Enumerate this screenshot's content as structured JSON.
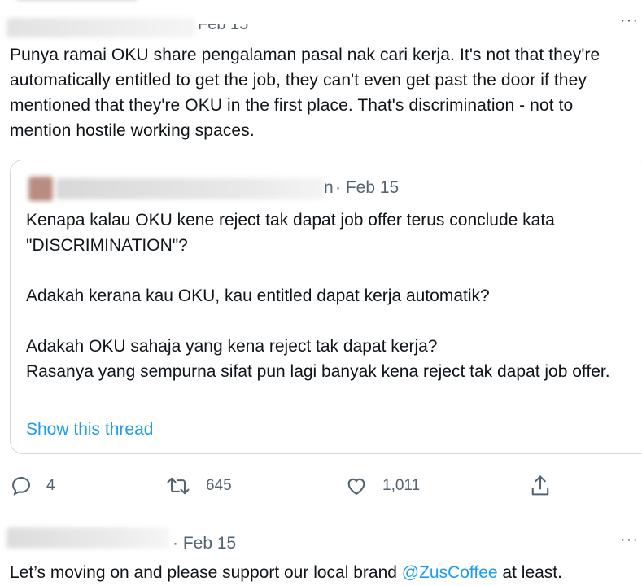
{
  "top_tweet": {
    "retweet_header": "",
    "time_text": "Feb 15",
    "text": "Punya ramai OKU share pengalaman pasal nak cari kerja. It's not that they're automatically entitled to get the job, they can't even get past the door if they mentioned that they're OKU in the first place. That's discrimination - not to mention hostile working spaces.",
    "more_icon": "more-dots-icon"
  },
  "quoted_tweet": {
    "name_suffix": "n",
    "time_text": "· Feb 15",
    "paragraphs": [
      "Kenapa kalau OKU kene reject tak dapat job offer terus conclude kata \"DISCRIMINATION\"?",
      "Adakah kerana kau OKU, kau entitled dapat kerja automatik?",
      "Adakah OKU sahaja yang kena reject tak dapat kerja?\nRasanya yang sempurna sifat pun lagi banyak kena reject tak dapat job offer."
    ],
    "show_thread": "Show this thread"
  },
  "actions": {
    "reply_count": "4",
    "retweet_count": "645",
    "like_count": "1,011",
    "reply_icon": "reply-icon",
    "retweet_icon": "retweet-icon",
    "like_icon": "heart-icon",
    "share_icon": "share-icon"
  },
  "bottom_tweet": {
    "time_text": "· Feb 15",
    "text_before": "Let’s moving on and please support our local brand ",
    "mention": "@ZusCoffee",
    "text_after": " at least."
  },
  "colors": {
    "accent": "#1d9bf0",
    "secondary_text": "#536471",
    "border": "#cfd9de"
  }
}
